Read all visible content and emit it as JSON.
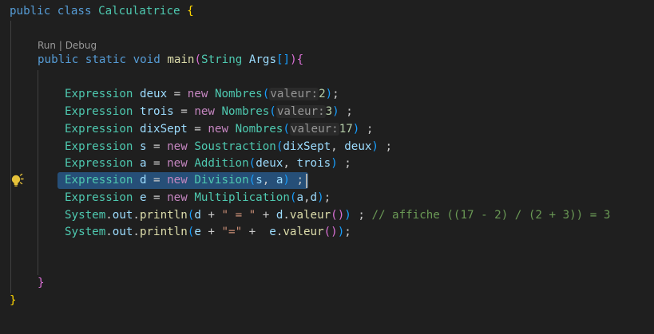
{
  "codelens": {
    "run": "Run",
    "sep": " | ",
    "debug": "Debug"
  },
  "code": {
    "l1": {
      "public": "public",
      "class": "class",
      "name": "Calculatrice",
      "brace": " {"
    },
    "l2": {
      "public": "public",
      "static": "static",
      "void": "void",
      "main": "main",
      "type": "String",
      "args": "Args"
    },
    "rows": [
      {
        "type": "Expression",
        "var": "deux",
        "cls": "Nombres",
        "hint": "valeur:",
        "arg": "2",
        "end": ";"
      },
      {
        "type": "Expression",
        "var": "trois",
        "cls": "Nombres",
        "hint": "valeur:",
        "arg": "3",
        "end": " ;"
      },
      {
        "type": "Expression",
        "var": "dixSept",
        "cls": "Nombres",
        "hint": "valeur:",
        "arg": "17",
        "end": " ;"
      },
      {
        "type": "Expression",
        "var": "s",
        "cls": "Soustraction",
        "a1": "dixSept",
        "a2": "deux",
        "end": " ;"
      },
      {
        "type": "Expression",
        "var": "a",
        "cls": "Addition",
        "a1": "deux",
        "a2": "trois",
        "end": " ;"
      },
      {
        "type": "Expression",
        "var": "d",
        "cls": "Division",
        "a1": "s",
        "a2": "a",
        "end": " ;"
      },
      {
        "type": "Expression",
        "var": "e",
        "cls": "Multiplication",
        "a1": "a",
        "a2": "d",
        "end": ";"
      }
    ],
    "p1": {
      "sys": "System",
      "out": "out",
      "println": "println",
      "v": "d",
      "str": "\" = \"",
      "v2": "d",
      "meth": "valeur",
      "comment": "// affiche ((17 - 2) / (2 + 3)) = 3"
    },
    "p2": {
      "sys": "System",
      "out": "out",
      "println": "println",
      "v": "e",
      "str": "\"=\"",
      "v2": "e",
      "meth": "valeur"
    },
    "kw_new": "new"
  }
}
